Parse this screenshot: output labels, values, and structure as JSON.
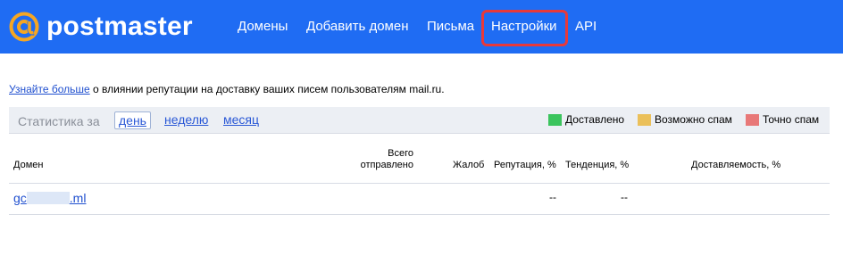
{
  "header": {
    "logo_text": "postmaster",
    "logo_icon": "at-sign-icon",
    "nav": [
      "Домены",
      "Добавить домен",
      "Письма",
      "Настройки",
      "API"
    ],
    "active_nav": "Настройки"
  },
  "intro": {
    "link": "Узнайте больше",
    "text": " о влиянии репутации на доставку ваших писем пользователям mail.ru."
  },
  "stats": {
    "label": "Статистика за",
    "periods": [
      "день",
      "неделю",
      "месяц"
    ],
    "selected_period": "день",
    "legend": [
      {
        "label": "Доставлено",
        "color": "#3bc45d"
      },
      {
        "label": "Возможно спам",
        "color": "#ebc05a"
      },
      {
        "label": "Точно спам",
        "color": "#e87878"
      }
    ]
  },
  "table": {
    "headers": {
      "domain": "Домен",
      "sent_line1": "Всего",
      "sent_line2": "отправлено",
      "complaints": "Жалоб",
      "reputation": "Репутация, %",
      "trend": "Тенденция, %",
      "deliverability": "Доставляемость, %"
    },
    "row": {
      "domain_start": "gc",
      "domain_end": ".ml",
      "reputation": "--",
      "trend": "--"
    }
  },
  "colors": {
    "topbar": "#1f6cf3",
    "active_outline": "#e8393a",
    "link": "#1f4fcf"
  }
}
